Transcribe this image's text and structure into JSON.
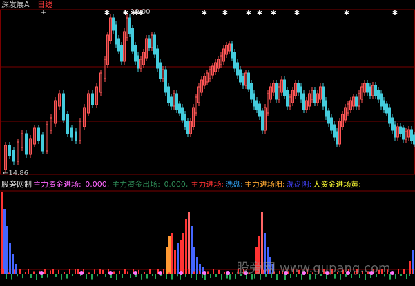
{
  "header": {
    "stock_title": "深发展A",
    "period": "日线",
    "price_label": "19.00",
    "low_label": "←14.86"
  },
  "indicator_bar": {
    "label": "股旁网制",
    "fields": [
      {
        "label": "主力资金进场:",
        "value": "0.000,",
        "color": "#ff66ff"
      },
      {
        "label": "主力资金出场:",
        "value": "0.000,",
        "color": "#2e8b57"
      },
      {
        "label": "主力进场:",
        "value": "",
        "color": "#ff3333"
      },
      {
        "label": "洗盘:",
        "value": "",
        "color": "#33aaff"
      },
      {
        "label": "主力进场阳:",
        "value": "",
        "color": "#ffaa33"
      },
      {
        "label": "洗盘阴:",
        "value": "",
        "color": "#4444ff"
      },
      {
        "label": "大资金进场黄:",
        "value": "",
        "color": "#ffff33"
      }
    ]
  },
  "watermark": {
    "text": "股旁网",
    "url": "www.gupang.com"
  },
  "colors": {
    "background": "#000000",
    "up_candle": "#ff5555",
    "down_candle": "#44ccdd",
    "grid": "#7a0000",
    "star_marker": "#ffffff"
  }
}
